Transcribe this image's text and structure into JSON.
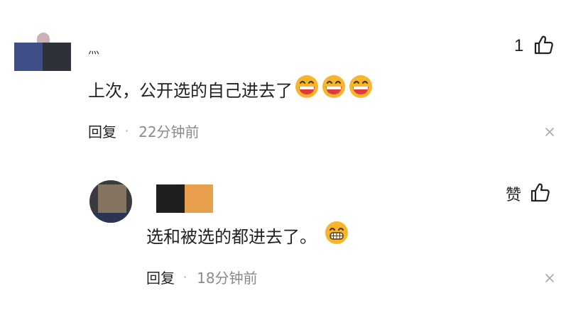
{
  "comment": {
    "username": "灬",
    "like_count": "1",
    "text": "上次，公开选的自己进去了",
    "emojis": [
      "laughing-emoji",
      "laughing-emoji",
      "laughing-emoji"
    ],
    "reply_label": "回复",
    "separator": "·",
    "time": "22分钟前"
  },
  "reply": {
    "like_label": "赞",
    "text": "选和被选的都进去了。",
    "emojis": [
      "grinning-emoji"
    ],
    "reply_label": "回复",
    "separator": "·",
    "time": "18分钟前"
  },
  "colors": {
    "text": "#222222",
    "muted": "#8a8a8a",
    "emoji_face": "#f7b52c",
    "emoji_mouth": "#e0393e"
  }
}
